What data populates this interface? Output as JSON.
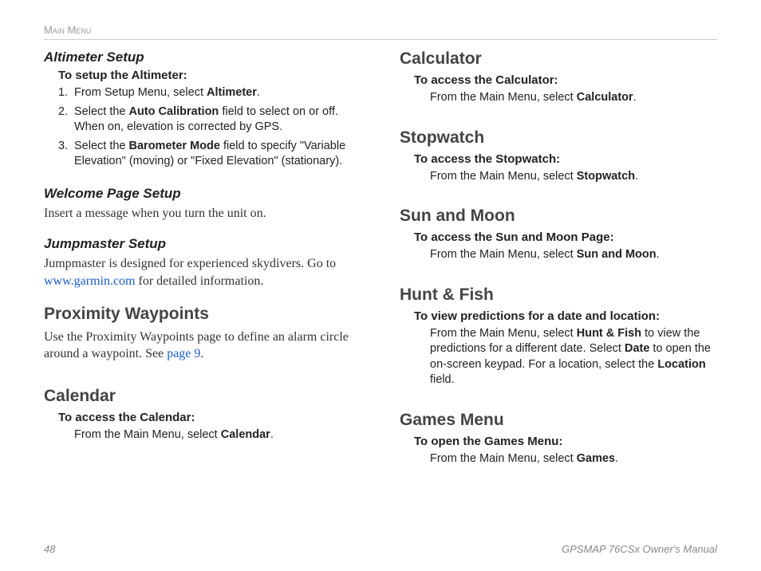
{
  "header": {
    "section": "Main Menu"
  },
  "footer": {
    "page": "48",
    "title": "GPSMAP 76CSx Owner's Manual"
  },
  "left": {
    "altimeter": {
      "title": "Altimeter Setup",
      "sub": "To setup the Altimeter:",
      "step1_a": "From Setup Menu, select ",
      "step1_b": "Altimeter",
      "step1_c": ".",
      "step2_a": "Select the ",
      "step2_b": "Auto Calibration",
      "step2_c": " field to select on or off. When on, elevation is corrected by GPS.",
      "step3_a": "Select the ",
      "step3_b": "Barometer Mode",
      "step3_c": " field to specify \"Variable Elevation\" (moving) or \"Fixed Elevation\" (stationary)."
    },
    "welcome": {
      "title": "Welcome Page Setup",
      "body": "Insert a message when you turn the unit on."
    },
    "jumpmaster": {
      "title": "Jumpmaster Setup",
      "body_a": "Jumpmaster is designed for experienced skydivers. Go to ",
      "link": "www.garmin.com",
      "body_b": " for detailed information."
    },
    "proximity": {
      "title": "Proximity Waypoints",
      "body_a": "Use the Proximity Waypoints page to define an alarm circle around a waypoint. See ",
      "link": "page 9",
      "body_b": "."
    },
    "calendar": {
      "title": "Calendar",
      "sub": "To access the Calendar:",
      "step_a": "From the Main Menu, select ",
      "step_b": "Calendar",
      "step_c": "."
    }
  },
  "right": {
    "calculator": {
      "title": "Calculator",
      "sub": "To access the Calculator:",
      "step_a": "From the Main Menu, select ",
      "step_b": "Calculator",
      "step_c": "."
    },
    "stopwatch": {
      "title": "Stopwatch",
      "sub": "To access the Stopwatch:",
      "step_a": "From the Main Menu, select ",
      "step_b": "Stopwatch",
      "step_c": "."
    },
    "sunmoon": {
      "title": "Sun and Moon",
      "sub": "To access the Sun and Moon Page:",
      "step_a": "From the Main Menu, select ",
      "step_b": "Sun and Moon",
      "step_c": "."
    },
    "huntfish": {
      "title": "Hunt & Fish",
      "sub": "To view predictions for a date and location:",
      "step_a": "From the Main Menu, select ",
      "step_b": "Hunt & Fish",
      "step_c": " to view the predictions for a different date. Select ",
      "step_d": "Date",
      "step_e": " to open the on-screen keypad. For a location, select the ",
      "step_f": "Location",
      "step_g": " field."
    },
    "games": {
      "title": "Games Menu",
      "sub": "To open the Games Menu:",
      "step_a": "From the Main Menu, select ",
      "step_b": "Games",
      "step_c": "."
    }
  }
}
